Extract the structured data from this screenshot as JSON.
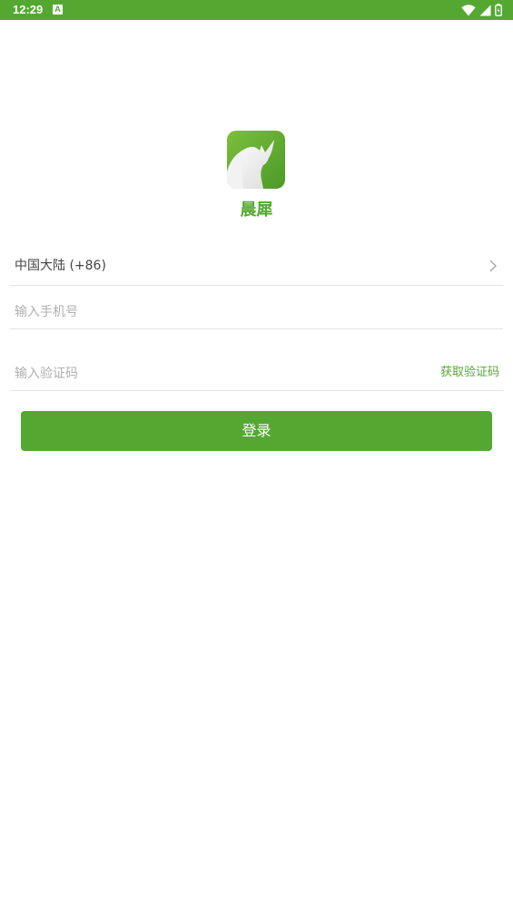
{
  "status_bar": {
    "time": "12:29",
    "notification_letter": "A",
    "icons": [
      "wifi-icon",
      "signal-icon",
      "battery-icon"
    ],
    "background": "#54a832"
  },
  "app": {
    "name": "晨犀",
    "logo_icon": "rhino-logo-icon"
  },
  "form": {
    "country_label": "中国大陆 (+86)",
    "phone_placeholder": "输入手机号",
    "phone_value": "",
    "code_placeholder": "输入验证码",
    "code_value": "",
    "get_code_label": "获取验证码",
    "login_label": "登录"
  },
  "colors": {
    "accent": "#54a832",
    "divider": "#e4e4e4",
    "placeholder": "#b0b0b0"
  }
}
